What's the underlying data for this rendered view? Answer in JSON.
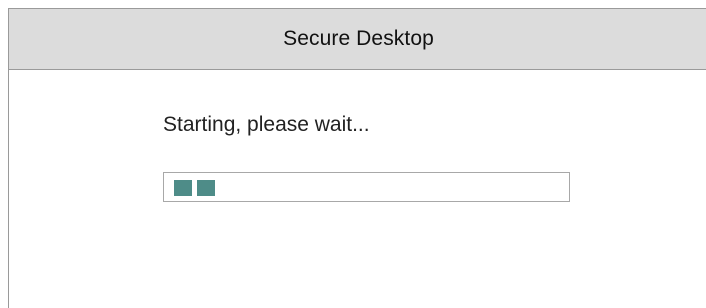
{
  "window": {
    "title": "Secure Desktop"
  },
  "content": {
    "status_text": "Starting, please wait..."
  },
  "progress": {
    "lit_blocks": 2,
    "block_color": "#4e8c88"
  }
}
